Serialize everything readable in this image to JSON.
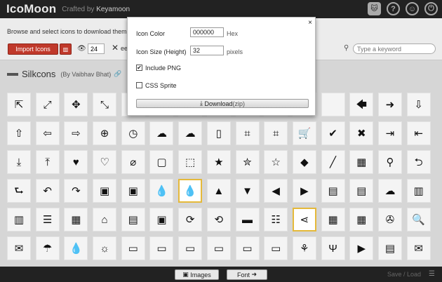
{
  "header": {
    "brand": "IcoMoon",
    "tagline_prefix": "Crafted by",
    "tagline_author": "Keyamoon",
    "icons": [
      "github-cat-icon",
      "help-icon",
      "smiley-icon",
      "power-icon"
    ]
  },
  "toolbar": {
    "intro": "Browse and select icons to download them or m",
    "import_label": "Import Icons",
    "library_label": "lib",
    "grid_size_value": "24",
    "x_label": "ee",
    "search_placeholder": "Type a keyword"
  },
  "set": {
    "name": "Silkcons",
    "author": "(By Vaibhav Bhat)"
  },
  "icon_grid": [
    [
      "⇱",
      "⤢",
      "✥",
      "⤡",
      "",
      "",
      "",
      "",
      "",
      "",
      "",
      "",
      "🡄",
      "➜",
      "⇩"
    ],
    [
      "⇧",
      "⇦",
      "⇨",
      "⊕",
      "◷",
      "☁",
      "☁",
      "▯",
      "⌗",
      "⌗",
      "🛒",
      "✔",
      "✖",
      "⇥",
      "⇤"
    ],
    [
      "⤓",
      "⤒",
      "♥",
      "♡",
      "⌀",
      "▢",
      "⬚",
      "★",
      "✮",
      "☆",
      "◆",
      "╱",
      "▦",
      "⚲",
      "⮌"
    ],
    [
      "⮑",
      "↶",
      "↷",
      "▣",
      "▣",
      "💧",
      "💧",
      "▲",
      "▼",
      "◀",
      "▶",
      "▤",
      "▤",
      "☁",
      "▥"
    ],
    [
      "▥",
      "☰",
      "▦",
      "⌂",
      "▤",
      "▣",
      "⟳",
      "⟲",
      "▬",
      "☷",
      "⋖",
      "▦",
      "▦",
      "✇",
      "🔍"
    ],
    [
      "✉",
      "☂",
      "💧",
      "☼",
      "▭",
      "▭",
      "▭",
      "▭",
      "▭",
      "▭",
      "⚘",
      "Ψ",
      "▶",
      "▤",
      "✉"
    ]
  ],
  "selected": [
    [
      3,
      6
    ],
    [
      4,
      10
    ]
  ],
  "footer": {
    "images_label": "Images",
    "font_label": "Font",
    "save_load": "Save / Load"
  },
  "modal": {
    "close": "×",
    "icon_color_label": "Icon Color",
    "icon_color_value": "000000",
    "icon_color_unit": "Hex",
    "icon_size_label": "Icon Size (Height)",
    "icon_size_value": "32",
    "icon_size_unit": "pixels",
    "include_png_label": "Include PNG",
    "include_png_checked": true,
    "css_sprite_label": "CSS Sprite",
    "css_sprite_checked": false,
    "download_label": "Download",
    "download_suffix": "(zip)"
  },
  "colors": {
    "accent": "#c0392b",
    "selected_border": "#e5b93a",
    "topbar": "#222222"
  }
}
